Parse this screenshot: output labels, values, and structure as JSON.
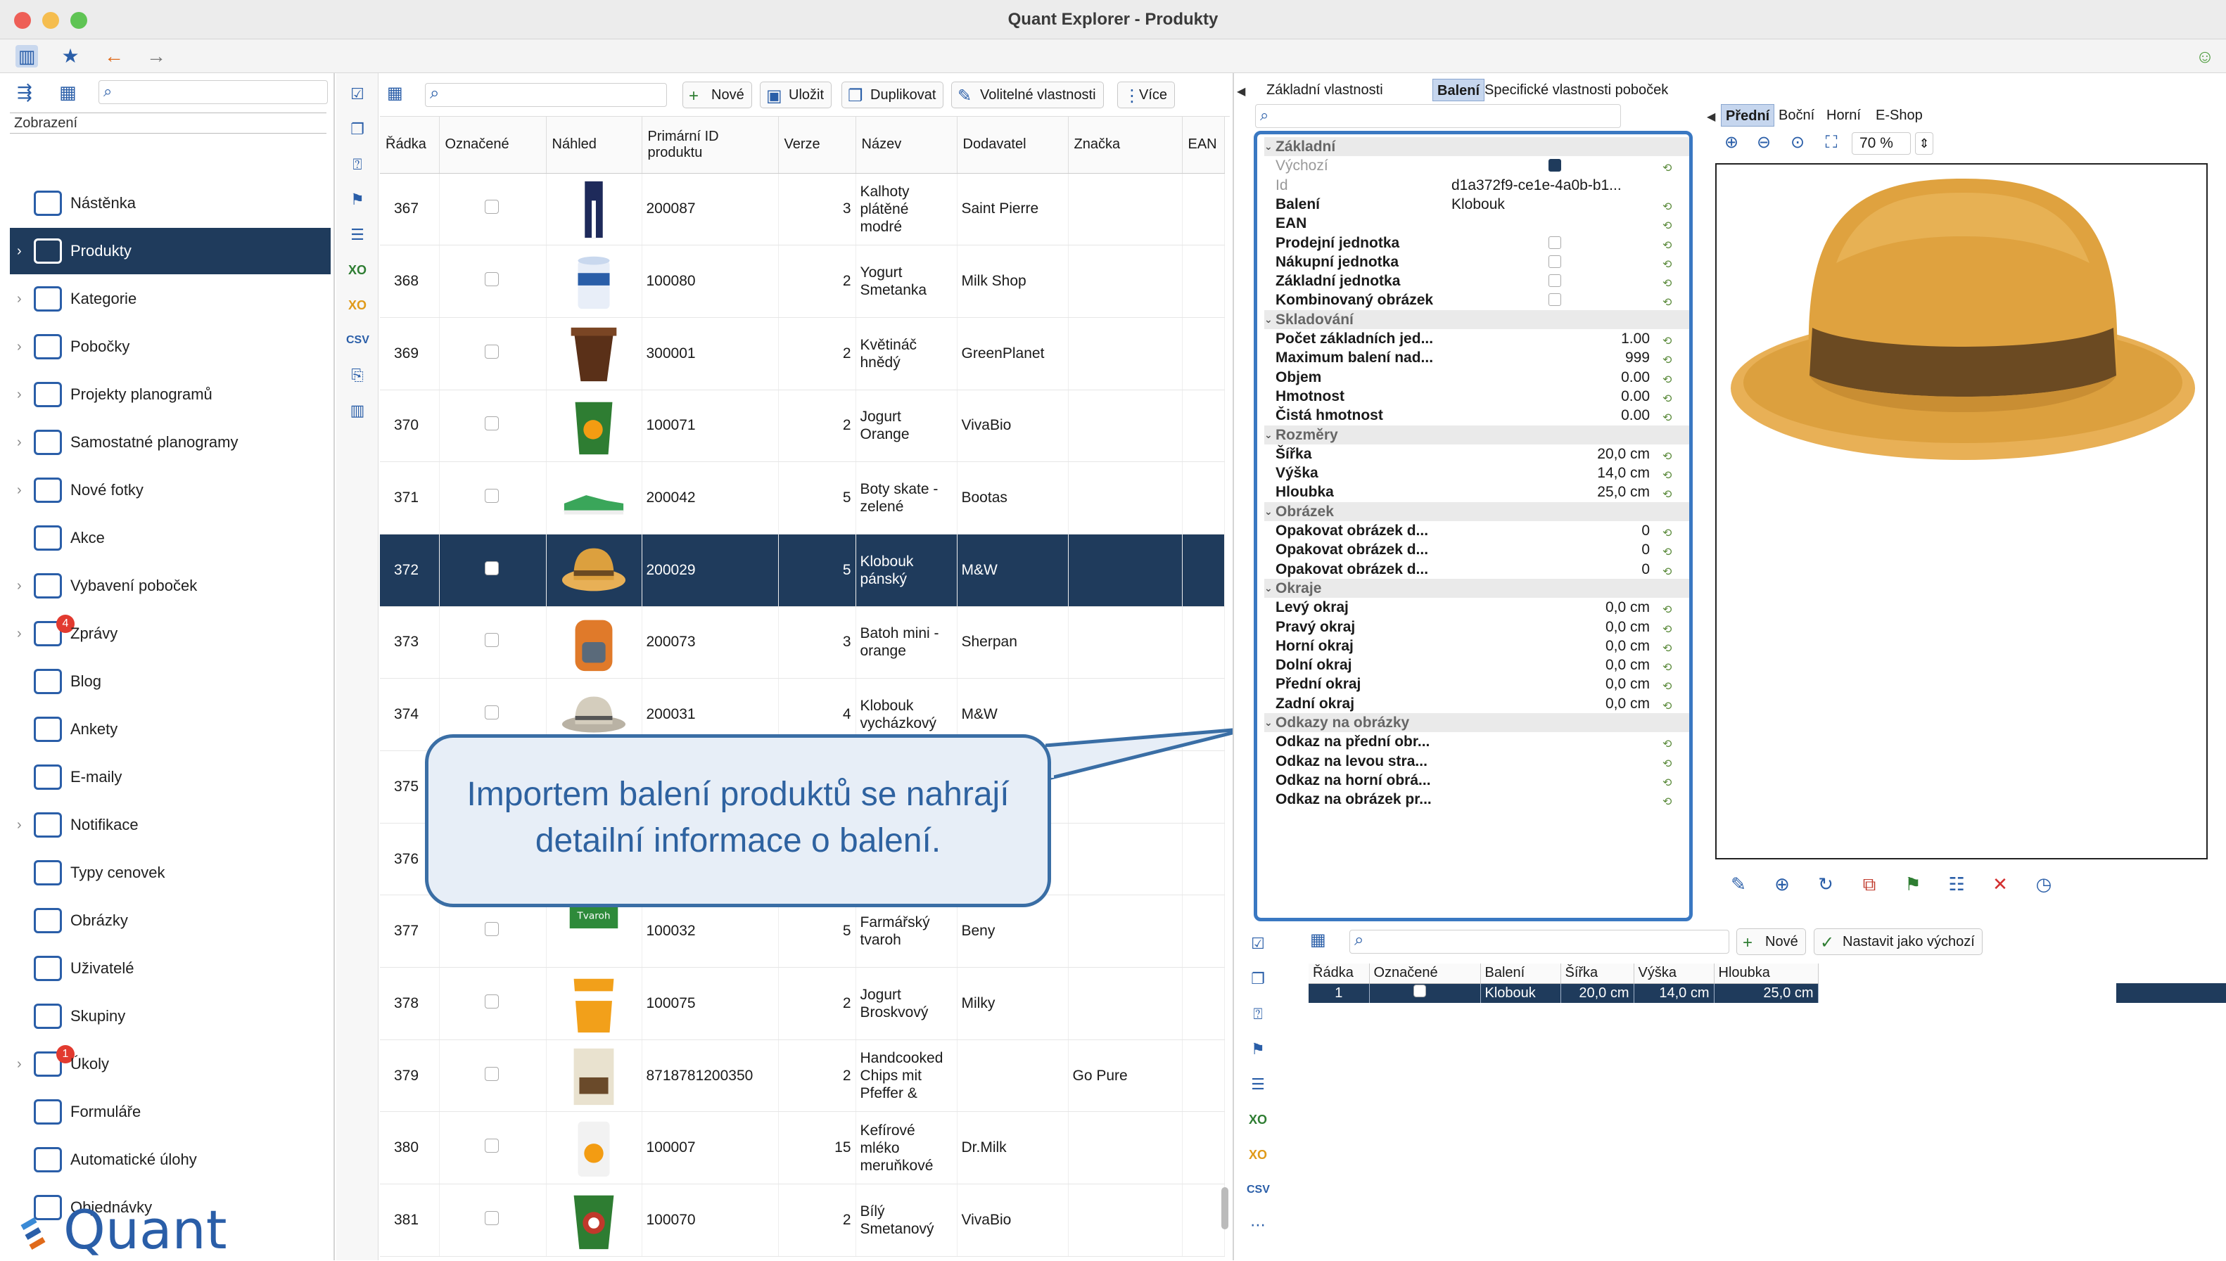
{
  "window": {
    "title": "Quant Explorer - Produkty"
  },
  "nav": {
    "section_label": "Zobrazení",
    "items": [
      {
        "label": "Nástěnka",
        "icon": "dashboard-icon",
        "chevron": false
      },
      {
        "label": "Produkty",
        "icon": "products-icon",
        "chevron": true,
        "selected": true
      },
      {
        "label": "Kategorie",
        "icon": "categories-icon",
        "chevron": true
      },
      {
        "label": "Pobočky",
        "icon": "branches-icon",
        "chevron": true
      },
      {
        "label": "Projekty planogramů",
        "icon": "planogram-projects-icon",
        "chevron": true
      },
      {
        "label": "Samostatné planogramy",
        "icon": "planograms-icon",
        "chevron": true
      },
      {
        "label": "Nové fotky",
        "icon": "camera-icon",
        "chevron": true
      },
      {
        "label": "Akce",
        "icon": "actions-icon",
        "chevron": false
      },
      {
        "label": "Vybavení poboček",
        "icon": "equipment-icon",
        "chevron": true
      },
      {
        "label": "Zprávy",
        "icon": "messages-icon",
        "chevron": true,
        "badge": "4"
      },
      {
        "label": "Blog",
        "icon": "blog-icon",
        "chevron": false
      },
      {
        "label": "Ankety",
        "icon": "polls-icon",
        "chevron": false
      },
      {
        "label": "E-maily",
        "icon": "email-icon",
        "chevron": false
      },
      {
        "label": "Notifikace",
        "icon": "notification-icon",
        "chevron": true
      },
      {
        "label": "Typy cenovek",
        "icon": "price-tag-icon",
        "chevron": false
      },
      {
        "label": "Obrázky",
        "icon": "image-icon",
        "chevron": false
      },
      {
        "label": "Uživatelé",
        "icon": "users-icon",
        "chevron": false
      },
      {
        "label": "Skupiny",
        "icon": "groups-icon",
        "chevron": false
      },
      {
        "label": "Úkoly",
        "icon": "tasks-icon",
        "chevron": true,
        "badge": "1"
      },
      {
        "label": "Formuláře",
        "icon": "forms-icon",
        "chevron": false
      },
      {
        "label": "Automatické úlohy",
        "icon": "auto-tasks-icon",
        "chevron": false
      },
      {
        "label": "Objednávky",
        "icon": "orders-icon",
        "chevron": false
      }
    ],
    "logo_text": "Quant"
  },
  "list": {
    "buttons": {
      "new": "Nové",
      "save": "Uložit",
      "duplicate": "Duplikovat",
      "optional": "Volitelné vlastnosti",
      "more": "Více"
    },
    "columns": [
      "Řádka",
      "Označené",
      "Náhled",
      "Primární ID produktu",
      "Verze",
      "Název",
      "Dodavatel",
      "Značka",
      "EAN"
    ],
    "rows": [
      {
        "row": "367",
        "id": "200087",
        "ver": "3",
        "name": "Kalhoty plátěné modré",
        "supplier": "Saint Pierre",
        "brand": "",
        "thumb": "pants-thumbnail-icon"
      },
      {
        "row": "368",
        "id": "100080",
        "ver": "2",
        "name": "Yogurt Smetanka",
        "supplier": "Milk Shop",
        "brand": "",
        "thumb": "yogurt-thumbnail-icon"
      },
      {
        "row": "369",
        "id": "300001",
        "ver": "2",
        "name": "Květináč hnědý",
        "supplier": "GreenPlanet",
        "brand": "",
        "thumb": "flowerpot-thumbnail-icon"
      },
      {
        "row": "370",
        "id": "100071",
        "ver": "2",
        "name": "Jogurt Orange",
        "supplier": "VivaBio",
        "brand": "",
        "thumb": "jogurt-orange-thumbnail-icon"
      },
      {
        "row": "371",
        "id": "200042",
        "ver": "5",
        "name": "Boty skate - zelené",
        "supplier": "Bootas",
        "brand": "",
        "thumb": "shoe-thumbnail-icon"
      },
      {
        "row": "372",
        "id": "200029",
        "ver": "5",
        "name": "Klobouk pánský",
        "supplier": "M&W",
        "brand": "",
        "thumb": "hat-thumbnail-icon",
        "selected": true
      },
      {
        "row": "373",
        "id": "200073",
        "ver": "3",
        "name": "Batoh mini - orange",
        "supplier": "Sherpan",
        "brand": "",
        "thumb": "backpack-thumbnail-icon"
      },
      {
        "row": "374",
        "id": "200031",
        "ver": "4",
        "name": "Klobouk vycházkový",
        "supplier": "M&W",
        "brand": "",
        "thumb": "walking-hat-thumbnail-icon"
      },
      {
        "row": "375",
        "id": "",
        "ver": "",
        "name": "",
        "supplier": "",
        "brand": "",
        "thumb": ""
      },
      {
        "row": "376",
        "id": "",
        "ver": "",
        "name": "",
        "supplier": "",
        "brand": "",
        "thumb": ""
      },
      {
        "row": "377",
        "id": "100032",
        "ver": "5",
        "name": "Farmářský tvaroh",
        "supplier": "Beny",
        "brand": "",
        "thumb": "tvaroh-thumbnail-icon"
      },
      {
        "row": "378",
        "id": "100075",
        "ver": "2",
        "name": "Jogurt Broskvový",
        "supplier": "Milky",
        "brand": "",
        "thumb": "peach-yogurt-thumbnail-icon"
      },
      {
        "row": "379",
        "id": "8718781200350",
        "ver": "2",
        "name": "Handcooked Chips mit Pfeffer &",
        "supplier": "",
        "brand": "Go Pure",
        "thumb": "chips-thumbnail-icon"
      },
      {
        "row": "380",
        "id": "100007",
        "ver": "15",
        "name": "Kefírové mléko meruňkové",
        "supplier": "Dr.Milk",
        "brand": "",
        "thumb": "kefir-thumbnail-icon"
      },
      {
        "row": "381",
        "id": "100070",
        "ver": "2",
        "name": "Bílý Smetanový",
        "supplier": "VivaBio",
        "brand": "",
        "thumb": "white-yogurt-thumbnail-icon"
      }
    ]
  },
  "callout": {
    "line1": "Importem balení produktů se nahrají",
    "line2": "detailní informace o balení."
  },
  "detail": {
    "tabs": [
      "Základní vlastnosti",
      "Balení",
      "Specifické vlastnosti poboček"
    ],
    "active_tab": "Balení",
    "preview_tabs": [
      "Přední",
      "Boční",
      "Horní",
      "E-Shop"
    ],
    "zoom": "70 %",
    "props": [
      {
        "type": "group",
        "k": "Základní"
      },
      {
        "k": "Výchozí",
        "dim": true,
        "check": "on"
      },
      {
        "k": "Id",
        "dim": true,
        "v": "d1a372f9-ce1e-4a0b-b1..."
      },
      {
        "k": "Balení",
        "v": "Klobouk"
      },
      {
        "k": "EAN",
        "v": ""
      },
      {
        "k": "Prodejní jednotka",
        "check": "off"
      },
      {
        "k": "Nákupní jednotka",
        "check": "off"
      },
      {
        "k": "Základní jednotka",
        "check": "off"
      },
      {
        "k": "Kombinovaný obrázek",
        "check": "off"
      },
      {
        "type": "group",
        "k": "Skladování"
      },
      {
        "k": "Počet základních jed...",
        "v": "1.00",
        "r": true
      },
      {
        "k": "Maximum balení nad...",
        "v": "999",
        "r": true
      },
      {
        "k": "Objem",
        "v": "0.00",
        "r": true
      },
      {
        "k": "Hmotnost",
        "v": "0.00",
        "r": true
      },
      {
        "k": "Čistá hmotnost",
        "v": "0.00",
        "r": true
      },
      {
        "type": "group",
        "k": "Rozměry"
      },
      {
        "k": "Šířka",
        "v": "20,0 cm",
        "r": true
      },
      {
        "k": "Výška",
        "v": "14,0 cm",
        "r": true
      },
      {
        "k": "Hloubka",
        "v": "25,0 cm",
        "r": true
      },
      {
        "type": "group",
        "k": "Obrázek"
      },
      {
        "k": "Opakovat obrázek d...",
        "v": "0",
        "r": true
      },
      {
        "k": "Opakovat obrázek d...",
        "v": "0",
        "r": true
      },
      {
        "k": "Opakovat obrázek d...",
        "v": "0",
        "r": true
      },
      {
        "type": "group",
        "k": "Okraje"
      },
      {
        "k": "Levý okraj",
        "v": "0,0 cm",
        "r": true
      },
      {
        "k": "Pravý okraj",
        "v": "0,0 cm",
        "r": true
      },
      {
        "k": "Horní okraj",
        "v": "0,0 cm",
        "r": true
      },
      {
        "k": "Dolní okraj",
        "v": "0,0 cm",
        "r": true
      },
      {
        "k": "Přední okraj",
        "v": "0,0 cm",
        "r": true
      },
      {
        "k": "Zadní okraj",
        "v": "0,0 cm",
        "r": true
      },
      {
        "type": "group",
        "k": "Odkazy na obrázky"
      },
      {
        "k": "Odkaz na přední obr...",
        "v": ""
      },
      {
        "k": "Odkaz na levou stra...",
        "v": ""
      },
      {
        "k": "Odkaz na horní obrá...",
        "v": ""
      },
      {
        "k": "Odkaz na obrázek pr...",
        "v": ""
      }
    ],
    "sub_buttons": {
      "new": "Nové",
      "set_default": "Nastavit jako výchozí"
    },
    "sub_columns": [
      "Řádka",
      "Označené",
      "Balení",
      "Šířka",
      "Výška",
      "Hloubka"
    ],
    "sub_rows": [
      {
        "row": "1",
        "pack": "Klobouk",
        "w": "20,0 cm",
        "h": "14,0 cm",
        "d": "25,0 cm"
      }
    ]
  },
  "colors": {
    "accent": "#2a5ea8",
    "selected_row": "#1f3b5c",
    "callout_border": "#3a6ea5",
    "hat": "#dca03e"
  }
}
